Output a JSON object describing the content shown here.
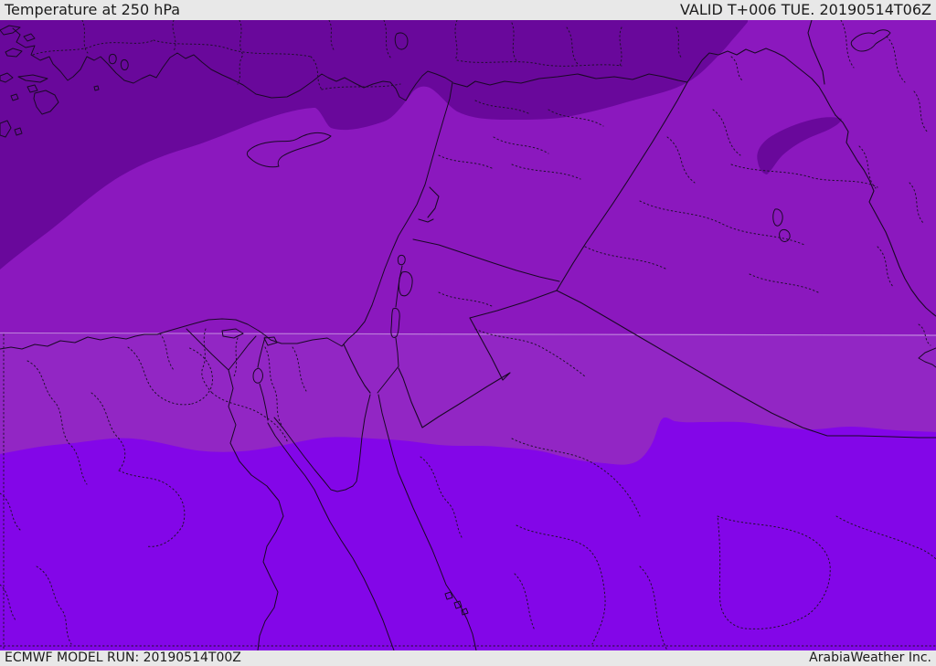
{
  "header": {
    "title": "Temperature at 250 hPa",
    "validity": "VALID T+006 TUE. 20190514T06Z"
  },
  "footer": {
    "model_run": "ECMWF MODEL RUN: 20190514T00Z",
    "provider": "ArabiaWeather Inc."
  },
  "map": {
    "parameter": "Temperature",
    "level": "250 hPa",
    "model": "ECMWF",
    "region": "Middle East / Eastern Mediterranean",
    "bands": [
      {
        "name": "coldest-north-band",
        "color": "#69089B"
      },
      {
        "name": "cold-main-band",
        "color": "#8B18BE"
      },
      {
        "name": "mid-band",
        "color": "#9226C4"
      },
      {
        "name": "warm-south-band",
        "color": "#8306E8"
      }
    ]
  },
  "colors": {
    "bar_bg": "#E8E8E8",
    "bar_text": "#1B1B1B",
    "band1": "#69089B",
    "band2": "#8B18BE",
    "band3": "#9226C4",
    "band4": "#8306E8",
    "line": "#1A0826",
    "faint_contour": "#E6D1F2"
  }
}
